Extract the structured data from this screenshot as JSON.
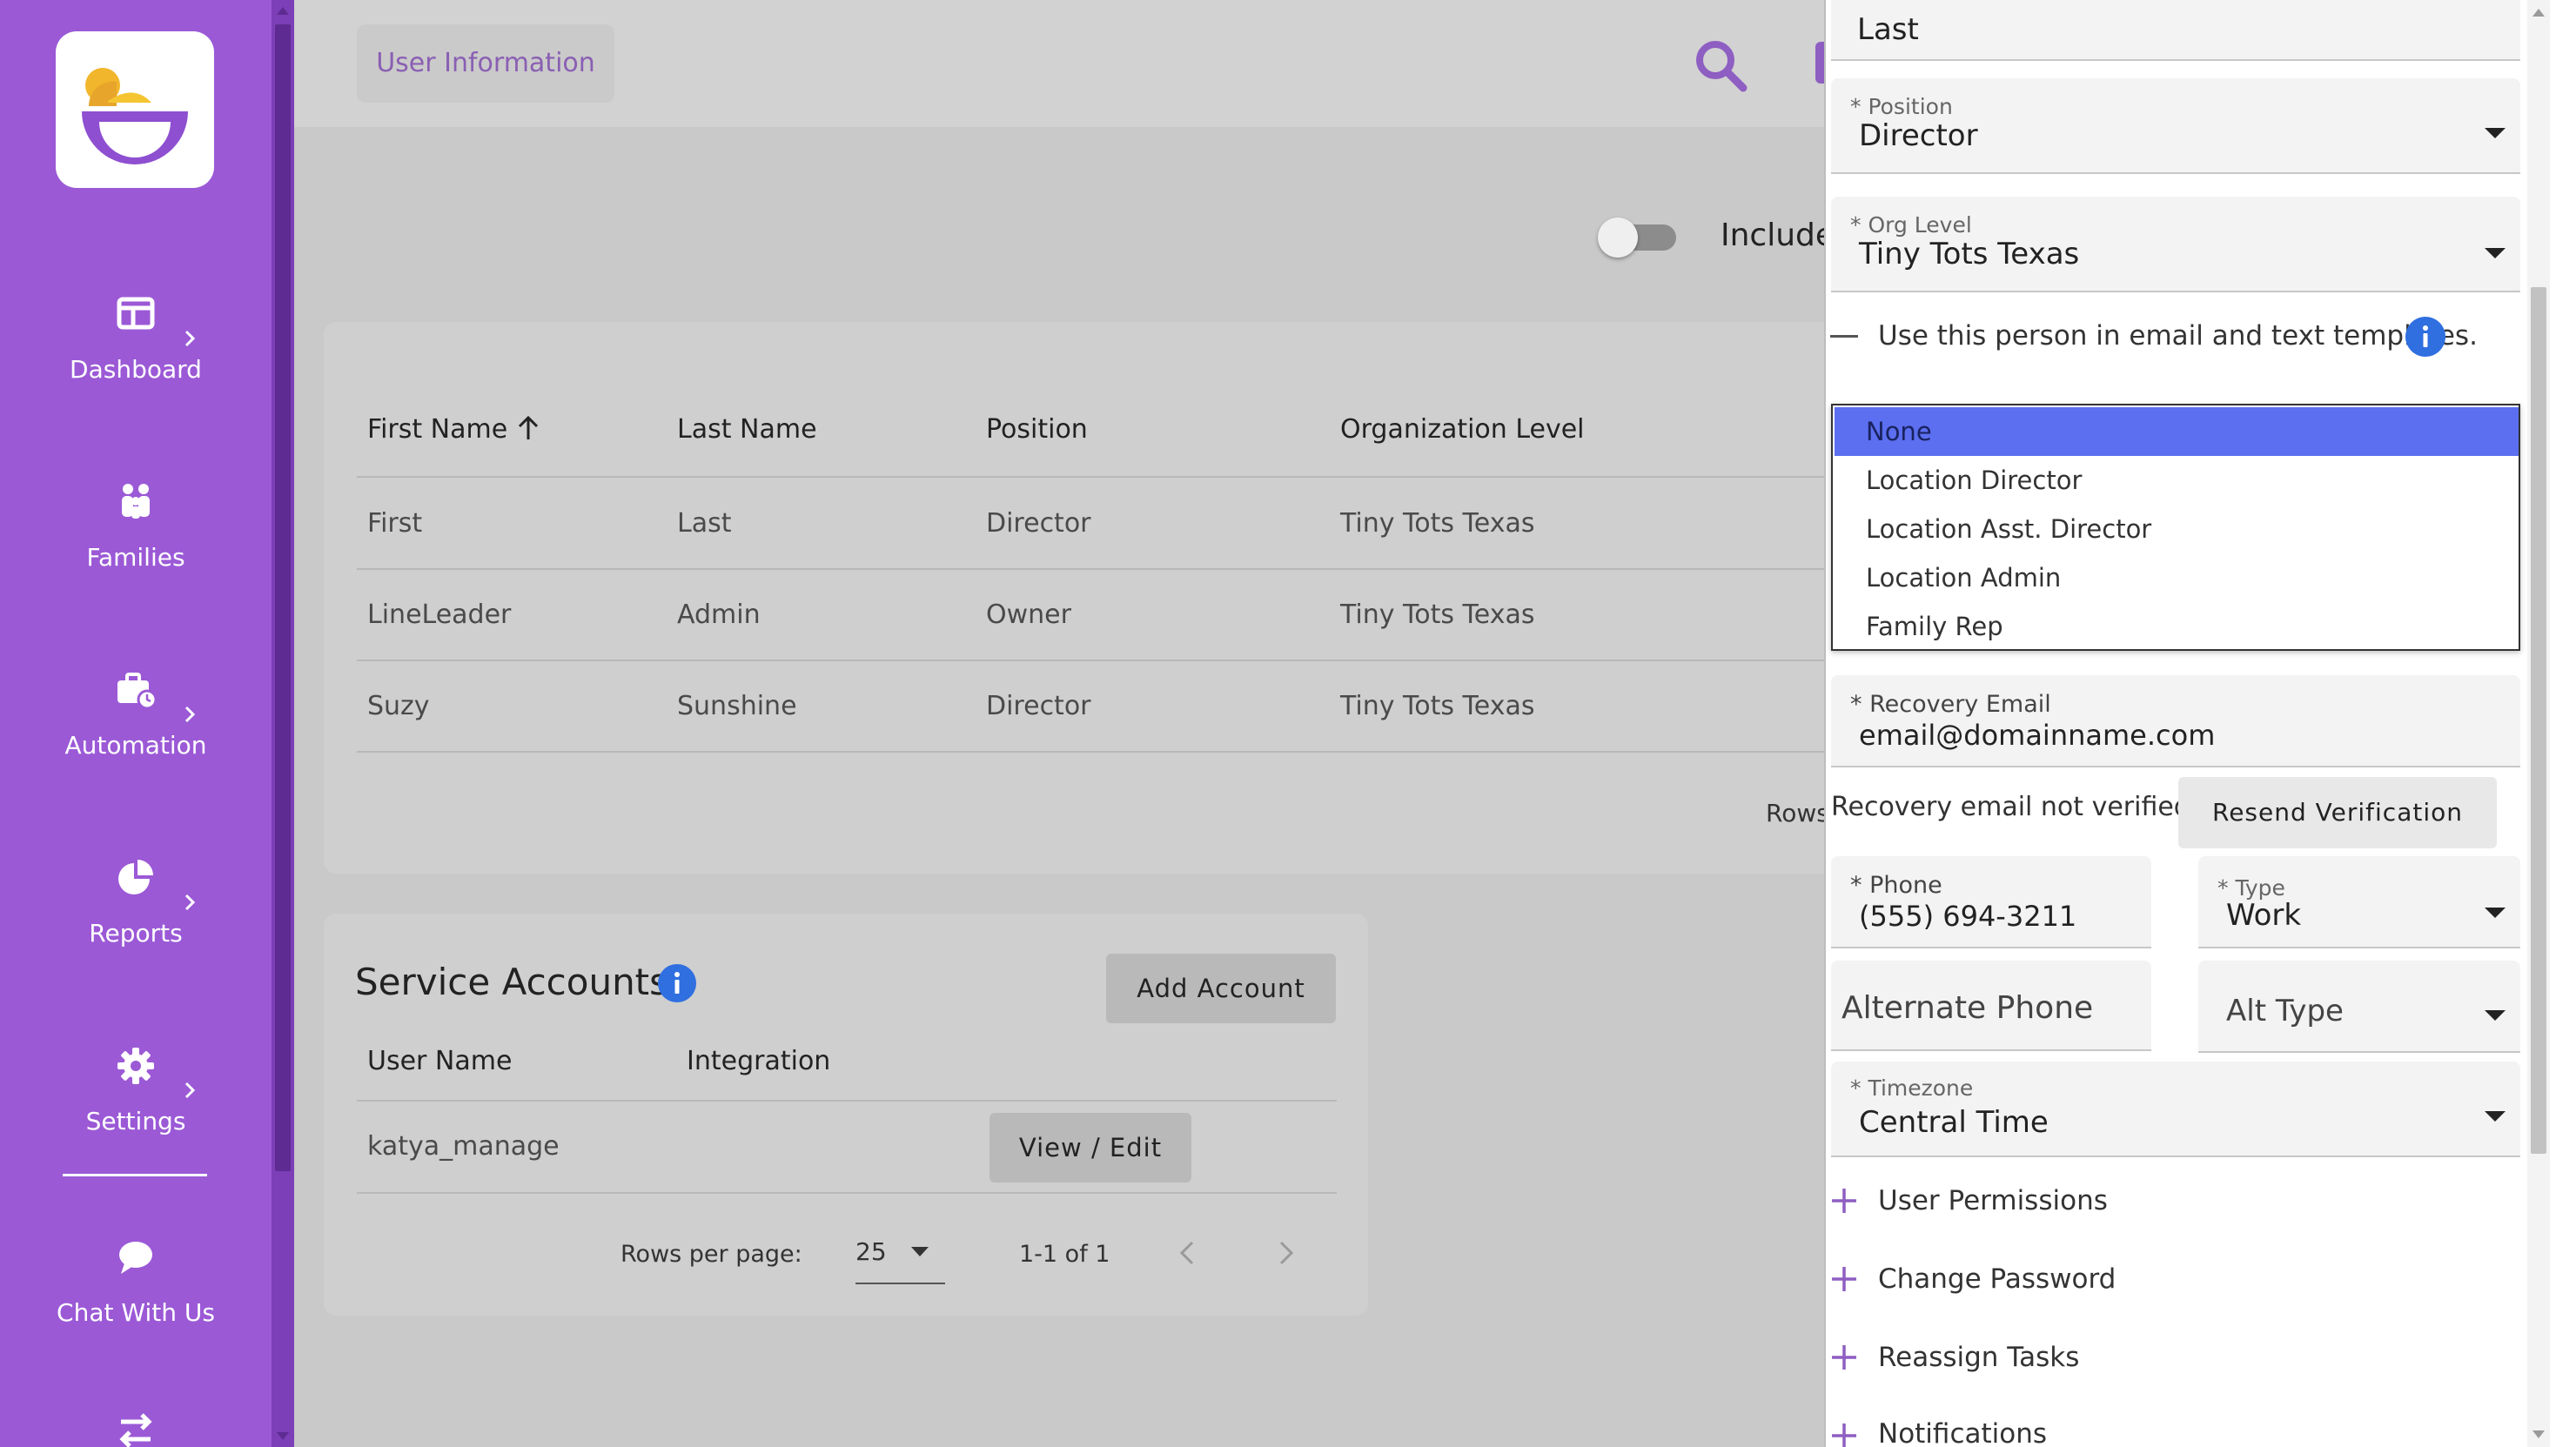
{
  "sidebar": {
    "items": [
      {
        "label": "Dashboard",
        "icon": "dashboard-icon"
      },
      {
        "label": "Families",
        "icon": "families-icon"
      },
      {
        "label": "Automation",
        "icon": "automation-icon"
      },
      {
        "label": "Reports",
        "icon": "reports-icon"
      },
      {
        "label": "Settings",
        "icon": "settings-icon"
      },
      {
        "label": "Chat With Us",
        "icon": "chat-icon"
      }
    ],
    "bottom_icon": "swap-icon"
  },
  "topbar": {
    "tab_label": "User Information",
    "search_icon": "search-icon"
  },
  "filter": {
    "toggle_label": "Include"
  },
  "users_table": {
    "columns": [
      "First Name",
      "Last Name",
      "Position",
      "Organization Level"
    ],
    "rows": [
      [
        "First",
        "Last",
        "Director",
        "Tiny Tots Texas"
      ],
      [
        "LineLeader",
        "Admin",
        "Owner",
        "Tiny Tots Texas"
      ],
      [
        "Suzy",
        "Sunshine",
        "Director",
        "Tiny Tots Texas"
      ]
    ],
    "rows_label": "Rows"
  },
  "service_accounts": {
    "title": "Service Accounts",
    "add_button": "Add Account",
    "columns": [
      "User Name",
      "Integration"
    ],
    "rows": [
      {
        "user_name": "katya_manage",
        "integration": "",
        "action": "View / Edit"
      }
    ],
    "rows_per_page_label": "Rows per page:",
    "rows_per_page_value": "25",
    "range": "1-1 of 1"
  },
  "panel": {
    "last_name_value": "Last",
    "position": {
      "label": "* Position",
      "value": "Director"
    },
    "org_level": {
      "label": "* Org Level",
      "value": "Tiny Tots Texas"
    },
    "templates_text": "Use this person in email and text templates.",
    "dropdown_options": [
      "None",
      "Location Director",
      "Location Asst. Director",
      "Location Admin",
      "Family Rep"
    ],
    "dropdown_selected": "None",
    "recovery_email": {
      "label": "* Recovery Email",
      "value": "email@domainname.com"
    },
    "recovery_note": "Recovery email not verified.",
    "resend_button": "Resend Verification",
    "phone": {
      "label": "* Phone",
      "value": "(555) 694-3211"
    },
    "type": {
      "label": "* Type",
      "value": "Work"
    },
    "alt_phone_label": "Alternate Phone",
    "alt_type_label": "Alt Type",
    "timezone": {
      "label": "* Timezone",
      "value": "Central Time"
    },
    "accordions": [
      "User Permissions",
      "Change Password",
      "Reassign Tasks",
      "Notifications"
    ]
  },
  "colors": {
    "sidebar": "#9b59d6",
    "accent": "#8e5ec2",
    "selected_option": "#5b6ff0",
    "info_blue": "#2f6fe0"
  }
}
